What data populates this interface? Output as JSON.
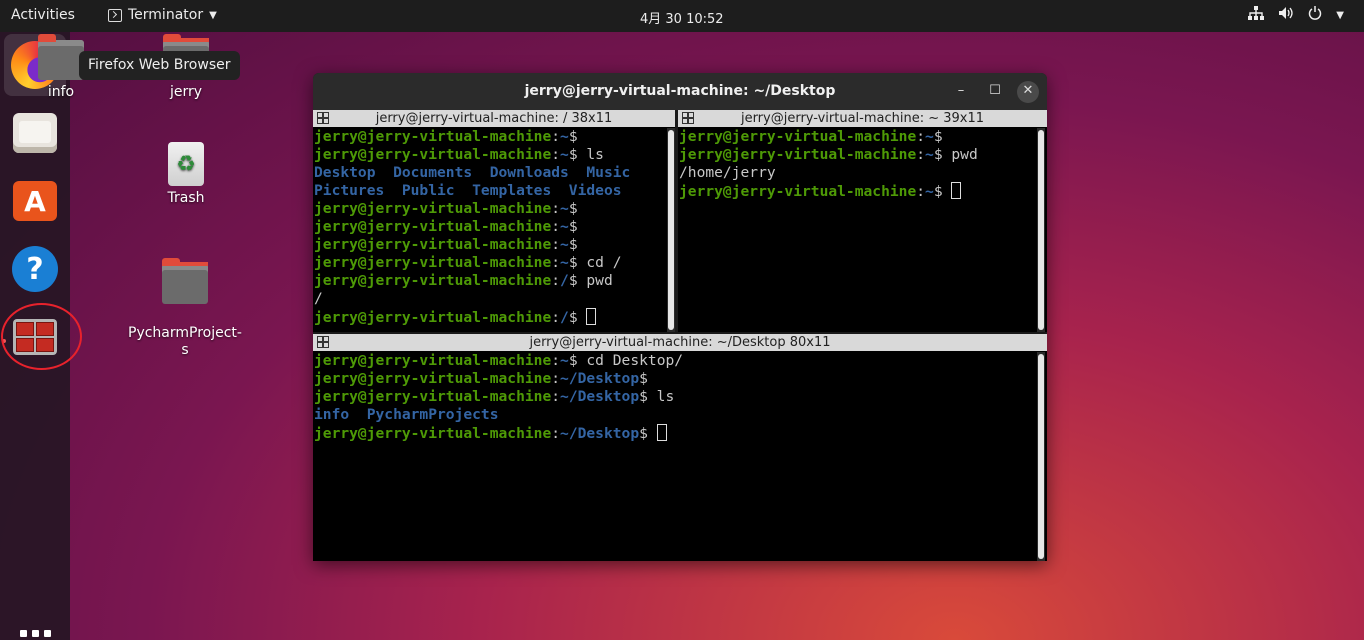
{
  "topbar": {
    "activities": "Activities",
    "app_name": "Terminator",
    "clock": "4月 30  10:52"
  },
  "tray": {
    "network": "network-icon",
    "volume": "volume-icon",
    "power": "power-icon"
  },
  "dock": {
    "tooltip": "Firefox Web Browser",
    "items": [
      "firefox",
      "files",
      "ubuntu-software",
      "help",
      "terminator"
    ]
  },
  "desktop": {
    "icons": [
      {
        "label": "info"
      },
      {
        "label": "jerry"
      },
      {
        "label": "Trash"
      },
      {
        "label": "PycharmProject-\ns"
      }
    ]
  },
  "window": {
    "title": "jerry@jerry-virtual-machine: ~/Desktop",
    "panes": [
      {
        "title": "jerry@jerry-virtual-machine: / 38x11"
      },
      {
        "title": "jerry@jerry-virtual-machine: ~ 39x11"
      },
      {
        "title": "jerry@jerry-virtual-machine: ~/Desktop 80x11"
      }
    ]
  },
  "prompt_user": "jerry@jerry-virtual-machine",
  "terminal": {
    "pane1": [
      {
        "path": "~",
        "cmd": ""
      },
      {
        "path": "~",
        "cmd": " ls"
      },
      {
        "out_blue": "Desktop  Documents  Downloads  Music"
      },
      {
        "out_blue": "Pictures  Public  Templates  Videos"
      },
      {
        "path": "~",
        "cmd": ""
      },
      {
        "path": "~",
        "cmd": ""
      },
      {
        "path": "~",
        "cmd": ""
      },
      {
        "path": "~",
        "cmd": " cd /"
      },
      {
        "path": "/",
        "cmd": " pwd"
      },
      {
        "out": "/"
      },
      {
        "path": "/",
        "cmd": " ",
        "cursor": true
      }
    ],
    "pane2": [
      {
        "path": "~",
        "cmd": ""
      },
      {
        "path": "~",
        "cmd": " pwd"
      },
      {
        "out": "/home/jerry"
      },
      {
        "path": "~",
        "cmd": " ",
        "cursor": true
      }
    ],
    "pane3": [
      {
        "path": "~",
        "cmd": " cd Desktop/"
      },
      {
        "path": "~/Desktop",
        "cmd": ""
      },
      {
        "path": "~/Desktop",
        "cmd": " ls"
      },
      {
        "out_blue": "info  PycharmProjects"
      },
      {
        "path": "~/Desktop",
        "cmd": " ",
        "cursor": true
      }
    ]
  }
}
